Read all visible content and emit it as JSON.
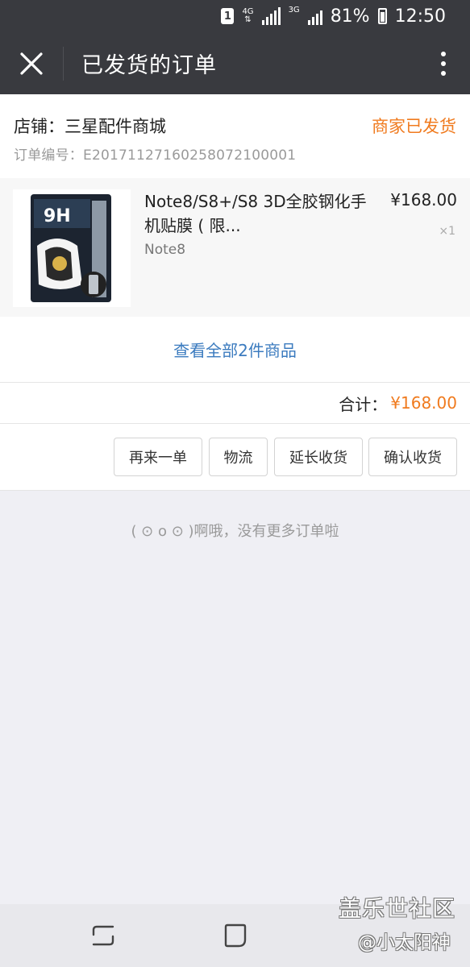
{
  "status_bar": {
    "sim": "1",
    "net1": "4G",
    "net2": "3G",
    "battery": "81%",
    "time": "12:50"
  },
  "header": {
    "title": "已发货的订单",
    "close_icon": "close-icon",
    "more_icon": "more-vertical-icon"
  },
  "order": {
    "store": "店铺：三星配件商城",
    "status": "商家已发货",
    "order_no": "订单编号：E20171127160258072100001",
    "item": {
      "name": "Note8/S8+/S8 3D全胶钢化手机贴膜 ( 限...",
      "variant": "Note8",
      "price": "¥168.00",
      "qty": "×1",
      "image_text": "9H"
    },
    "view_all": "查看全部2件商品",
    "total_label": "合计：",
    "total_value": "¥168.00"
  },
  "actions": [
    "再来一单",
    "物流",
    "延长收货",
    "确认收货"
  ],
  "footer_note": "( ⊙ o ⊙ )啊哦，没有更多订单啦",
  "watermark": {
    "site": "盖乐世社区",
    "user": "@小太阳神"
  },
  "colors": {
    "bar": "#393a3f",
    "accent": "#f07b1f",
    "link": "#3b7bbf"
  }
}
